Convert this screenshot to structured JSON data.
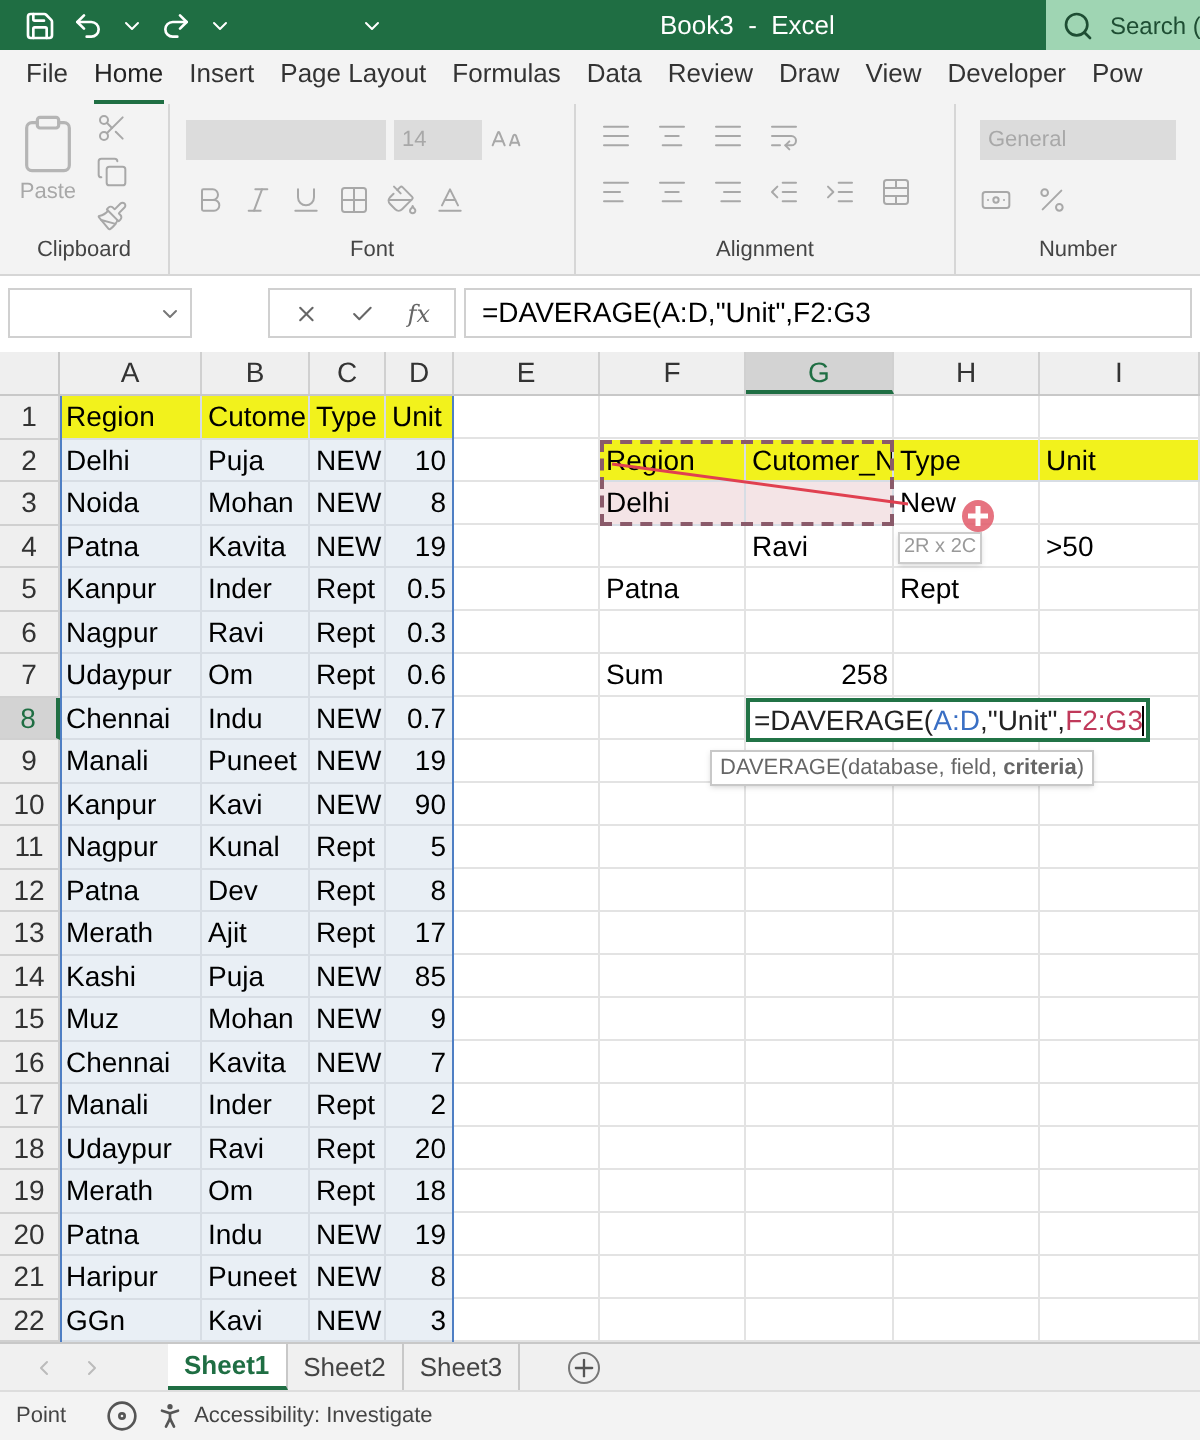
{
  "title_bar": {
    "title": "Book3  -  Excel",
    "search": "Search ("
  },
  "menu_tabs": [
    {
      "label": "File",
      "selected": false
    },
    {
      "label": "Home",
      "selected": true
    },
    {
      "label": "Insert",
      "selected": false
    },
    {
      "label": "Page Layout",
      "selected": false
    },
    {
      "label": "Formulas",
      "selected": false
    },
    {
      "label": "Data",
      "selected": false
    },
    {
      "label": "Review",
      "selected": false
    },
    {
      "label": "Draw",
      "selected": false
    },
    {
      "label": "View",
      "selected": false
    },
    {
      "label": "Developer",
      "selected": false
    },
    {
      "label": "Pow",
      "selected": false
    }
  ],
  "ribbon": {
    "groups": [
      {
        "kind": "clipboard",
        "label": "Clipboard",
        "paste_label": "Paste"
      },
      {
        "kind": "font",
        "label": "Font",
        "font_size": "14"
      },
      {
        "kind": "alignment",
        "label": "Alignment"
      },
      {
        "kind": "number",
        "label": "Number",
        "format": "General"
      }
    ]
  },
  "formula_bar": {
    "function_label": "fx",
    "formula": "=DAVERAGE(A:D,\"Unit\",F2:G3"
  },
  "columns": [
    {
      "label": "A",
      "selected": false
    },
    {
      "label": "B",
      "selected": false
    },
    {
      "label": "C",
      "selected": false
    },
    {
      "label": "D",
      "selected": false
    },
    {
      "label": "E",
      "selected": false
    },
    {
      "label": "F",
      "selected": false
    },
    {
      "label": "G",
      "selected": true
    },
    {
      "label": "H",
      "selected": false
    },
    {
      "label": "I",
      "selected": false
    }
  ],
  "rows": [
    {
      "header": "1",
      "selected": false,
      "cells": [
        {
          "kind": "text",
          "text": "Region",
          "color": "#f2f21c"
        },
        {
          "kind": "text",
          "text": "Cutome",
          "color": "#f2f21c"
        },
        {
          "kind": "text",
          "text": "Type",
          "color": "#f2f21c"
        },
        {
          "kind": "text",
          "text": "Unit",
          "color": "#f2f21c"
        },
        null,
        null,
        null,
        null,
        null
      ]
    },
    {
      "header": "2",
      "selected": false,
      "cells": [
        {
          "kind": "text",
          "text": "Delhi",
          "color": "#e9eff5"
        },
        {
          "kind": "text",
          "text": "Puja",
          "color": "#e9eff5"
        },
        {
          "kind": "text",
          "text": "NEW",
          "color": "#e9eff5"
        },
        {
          "kind": "number",
          "text": "10",
          "color": "#e9eff5"
        },
        null,
        {
          "kind": "text",
          "text": "Region",
          "color": "#f2f21c"
        },
        {
          "kind": "text",
          "text": "Cutomer_N",
          "color": "#f2f21c"
        },
        {
          "kind": "text",
          "text": "Type",
          "color": "#f2f21c"
        },
        {
          "kind": "text",
          "text": "Unit",
          "color": "#f2f21c"
        }
      ]
    },
    {
      "header": "3",
      "selected": false,
      "cells": [
        {
          "kind": "text",
          "text": "Noida",
          "color": "#e9eff5"
        },
        {
          "kind": "text",
          "text": "Mohan",
          "color": "#e9eff5"
        },
        {
          "kind": "text",
          "text": "NEW",
          "color": "#e9eff5"
        },
        {
          "kind": "number",
          "text": "8",
          "color": "#e9eff5"
        },
        null,
        {
          "kind": "text",
          "text": "Delhi",
          "color": "#f4e4e6"
        },
        {
          "kind": "text",
          "color": "#f4e4e6"
        },
        {
          "kind": "text",
          "text": "New"
        },
        null
      ]
    },
    {
      "header": "4",
      "selected": false,
      "cells": [
        {
          "kind": "text",
          "text": "Patna",
          "color": "#e9eff5"
        },
        {
          "kind": "text",
          "text": "Kavita",
          "color": "#e9eff5"
        },
        {
          "kind": "text",
          "text": "NEW",
          "color": "#e9eff5"
        },
        {
          "kind": "number",
          "text": "19",
          "color": "#e9eff5"
        },
        null,
        null,
        {
          "kind": "text",
          "text": "Ravi"
        },
        null,
        {
          "kind": "text",
          "text": ">50"
        }
      ]
    },
    {
      "header": "5",
      "selected": false,
      "cells": [
        {
          "kind": "text",
          "text": "Kanpur",
          "color": "#e9eff5"
        },
        {
          "kind": "text",
          "text": "Inder",
          "color": "#e9eff5"
        },
        {
          "kind": "text",
          "text": "Rept",
          "color": "#e9eff5"
        },
        {
          "kind": "number",
          "text": "0.5",
          "color": "#e9eff5"
        },
        null,
        {
          "kind": "text",
          "text": "Patna"
        },
        null,
        {
          "kind": "text",
          "text": "Rept"
        },
        null
      ]
    },
    {
      "header": "6",
      "selected": false,
      "cells": [
        {
          "kind": "text",
          "text": "Nagpur",
          "color": "#e9eff5"
        },
        {
          "kind": "text",
          "text": "Ravi",
          "color": "#e9eff5"
        },
        {
          "kind": "text",
          "text": "Rept",
          "color": "#e9eff5"
        },
        {
          "kind": "number",
          "text": "0.3",
          "color": "#e9eff5"
        },
        null,
        null,
        null,
        null,
        null
      ]
    },
    {
      "header": "7",
      "selected": false,
      "cells": [
        {
          "kind": "text",
          "text": "Udaypur",
          "color": "#e9eff5"
        },
        {
          "kind": "text",
          "text": "Om",
          "color": "#e9eff5"
        },
        {
          "kind": "text",
          "text": "Rept",
          "color": "#e9eff5"
        },
        {
          "kind": "number",
          "text": "0.6",
          "color": "#e9eff5"
        },
        null,
        {
          "kind": "text",
          "text": "Sum"
        },
        {
          "kind": "number",
          "text": "258"
        },
        null,
        null
      ]
    },
    {
      "header": "8",
      "selected": true,
      "cells": [
        {
          "kind": "text",
          "text": "Chennai",
          "color": "#e9eff5"
        },
        {
          "kind": "text",
          "text": "Indu",
          "color": "#e9eff5"
        },
        {
          "kind": "text",
          "text": "NEW",
          "color": "#e9eff5"
        },
        {
          "kind": "number",
          "text": "0.7",
          "color": "#e9eff5"
        },
        null,
        null,
        {
          "kind": "editor",
          "parts": [
            {
              "text": "=DAVERAGE(",
              "color": "#222222"
            },
            {
              "text": "A:D",
              "color": "#3a6fc4"
            },
            {
              "text": ",\"Unit\",",
              "color": "#222222"
            },
            {
              "text": "F2:G3",
              "color": "#c0395a"
            }
          ],
          "tooltip": "DAVERAGE(database, field, **criteria**)"
        },
        null,
        null
      ]
    },
    {
      "header": "9",
      "selected": false,
      "cells": [
        {
          "kind": "text",
          "text": "Manali",
          "color": "#e9eff5"
        },
        {
          "kind": "text",
          "text": "Puneet",
          "color": "#e9eff5"
        },
        {
          "kind": "text",
          "text": "NEW",
          "color": "#e9eff5"
        },
        {
          "kind": "number",
          "text": "19",
          "color": "#e9eff5"
        },
        null,
        null,
        null,
        null,
        null
      ]
    },
    {
      "header": "10",
      "selected": false,
      "cells": [
        {
          "kind": "text",
          "text": "Kanpur",
          "color": "#e9eff5"
        },
        {
          "kind": "text",
          "text": "Kavi",
          "color": "#e9eff5"
        },
        {
          "kind": "text",
          "text": "NEW",
          "color": "#e9eff5"
        },
        {
          "kind": "number",
          "text": "90",
          "color": "#e9eff5"
        },
        null,
        null,
        null,
        null,
        null
      ]
    },
    {
      "header": "11",
      "selected": false,
      "cells": [
        {
          "kind": "text",
          "text": "Nagpur",
          "color": "#e9eff5"
        },
        {
          "kind": "text",
          "text": "Kunal",
          "color": "#e9eff5"
        },
        {
          "kind": "text",
          "text": "Rept",
          "color": "#e9eff5"
        },
        {
          "kind": "number",
          "text": "5",
          "color": "#e9eff5"
        },
        null,
        null,
        null,
        null,
        null
      ]
    },
    {
      "header": "12",
      "selected": false,
      "cells": [
        {
          "kind": "text",
          "text": "Patna",
          "color": "#e9eff5"
        },
        {
          "kind": "text",
          "text": "Dev",
          "color": "#e9eff5"
        },
        {
          "kind": "text",
          "text": "Rept",
          "color": "#e9eff5"
        },
        {
          "kind": "number",
          "text": "8",
          "color": "#e9eff5"
        },
        null,
        null,
        null,
        null,
        null
      ]
    },
    {
      "header": "13",
      "selected": false,
      "cells": [
        {
          "kind": "text",
          "text": "Merath",
          "color": "#e9eff5"
        },
        {
          "kind": "text",
          "text": "Ajit",
          "color": "#e9eff5"
        },
        {
          "kind": "text",
          "text": "Rept",
          "color": "#e9eff5"
        },
        {
          "kind": "number",
          "text": "17",
          "color": "#e9eff5"
        },
        null,
        null,
        null,
        null,
        null
      ]
    },
    {
      "header": "14",
      "selected": false,
      "cells": [
        {
          "kind": "text",
          "text": "Kashi",
          "color": "#e9eff5"
        },
        {
          "kind": "text",
          "text": "Puja",
          "color": "#e9eff5"
        },
        {
          "kind": "text",
          "text": "NEW",
          "color": "#e9eff5"
        },
        {
          "kind": "number",
          "text": "85",
          "color": "#e9eff5"
        },
        null,
        null,
        null,
        null,
        null
      ]
    },
    {
      "header": "15",
      "selected": false,
      "cells": [
        {
          "kind": "text",
          "text": "Muz",
          "color": "#e9eff5"
        },
        {
          "kind": "text",
          "text": "Mohan",
          "color": "#e9eff5"
        },
        {
          "kind": "text",
          "text": "NEW",
          "color": "#e9eff5"
        },
        {
          "kind": "number",
          "text": "9",
          "color": "#e9eff5"
        },
        null,
        null,
        null,
        null,
        null
      ]
    },
    {
      "header": "16",
      "selected": false,
      "cells": [
        {
          "kind": "text",
          "text": "Chennai",
          "color": "#e9eff5"
        },
        {
          "kind": "text",
          "text": "Kavita",
          "color": "#e9eff5"
        },
        {
          "kind": "text",
          "text": "NEW",
          "color": "#e9eff5"
        },
        {
          "kind": "number",
          "text": "7",
          "color": "#e9eff5"
        },
        null,
        null,
        null,
        null,
        null
      ]
    },
    {
      "header": "17",
      "selected": false,
      "cells": [
        {
          "kind": "text",
          "text": "Manali",
          "color": "#e9eff5"
        },
        {
          "kind": "text",
          "text": "Inder",
          "color": "#e9eff5"
        },
        {
          "kind": "text",
          "text": "Rept",
          "color": "#e9eff5"
        },
        {
          "kind": "number",
          "text": "2",
          "color": "#e9eff5"
        },
        null,
        null,
        null,
        null,
        null
      ]
    },
    {
      "header": "18",
      "selected": false,
      "cells": [
        {
          "kind": "text",
          "text": "Udaypur",
          "color": "#e9eff5"
        },
        {
          "kind": "text",
          "text": "Ravi",
          "color": "#e9eff5"
        },
        {
          "kind": "text",
          "text": "Rept",
          "color": "#e9eff5"
        },
        {
          "kind": "number",
          "text": "20",
          "color": "#e9eff5"
        },
        null,
        null,
        null,
        null,
        null
      ]
    },
    {
      "header": "19",
      "selected": false,
      "cells": [
        {
          "kind": "text",
          "text": "Merath",
          "color": "#e9eff5"
        },
        {
          "kind": "text",
          "text": "Om",
          "color": "#e9eff5"
        },
        {
          "kind": "text",
          "text": "Rept",
          "color": "#e9eff5"
        },
        {
          "kind": "number",
          "text": "18",
          "color": "#e9eff5"
        },
        null,
        null,
        null,
        null,
        null
      ]
    },
    {
      "header": "20",
      "selected": false,
      "cells": [
        {
          "kind": "text",
          "text": "Patna",
          "color": "#e9eff5"
        },
        {
          "kind": "text",
          "text": "Indu",
          "color": "#e9eff5"
        },
        {
          "kind": "text",
          "text": "NEW",
          "color": "#e9eff5"
        },
        {
          "kind": "number",
          "text": "19",
          "color": "#e9eff5"
        },
        null,
        null,
        null,
        null,
        null
      ]
    },
    {
      "header": "21",
      "selected": false,
      "cells": [
        {
          "kind": "text",
          "text": "Haripur",
          "color": "#e9eff5"
        },
        {
          "kind": "text",
          "text": "Puneet",
          "color": "#e9eff5"
        },
        {
          "kind": "text",
          "text": "NEW",
          "color": "#e9eff5"
        },
        {
          "kind": "number",
          "text": "8",
          "color": "#e9eff5"
        },
        null,
        null,
        null,
        null,
        null
      ]
    },
    {
      "header": "22",
      "selected": false,
      "cells": [
        {
          "kind": "text",
          "text": "GGn",
          "color": "#e9eff5"
        },
        {
          "kind": "text",
          "text": "Kavi",
          "color": "#e9eff5"
        },
        {
          "kind": "text",
          "text": "NEW",
          "color": "#e9eff5"
        },
        {
          "kind": "number",
          "text": "3",
          "color": "#e9eff5"
        },
        null,
        null,
        null,
        null,
        null
      ]
    }
  ],
  "selection_tooltip": "2R x 2C",
  "sheet_tabs": [
    {
      "label": "Sheet1",
      "selected": true
    },
    {
      "label": "Sheet2",
      "selected": false
    },
    {
      "label": "Sheet3",
      "selected": false
    }
  ],
  "status_bar": {
    "mode": "Point",
    "accessibility": "Accessibility: Investigate"
  }
}
